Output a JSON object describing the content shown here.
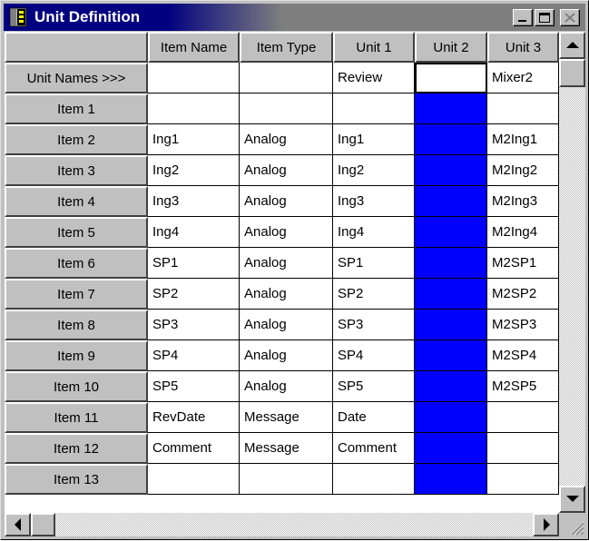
{
  "window": {
    "title": "Unit Definition"
  },
  "columns": [
    "Item Name",
    "Item Type",
    "Unit 1",
    "Unit 2",
    "Unit 3"
  ],
  "unit_names_label": "Unit Names >>>",
  "unit_names": [
    "",
    "",
    "Review",
    "",
    "Mixer2"
  ],
  "rows": [
    {
      "label": "Item 1",
      "cells": [
        "",
        "",
        "",
        "",
        ""
      ]
    },
    {
      "label": "Item 2",
      "cells": [
        "Ing1",
        "Analog",
        "Ing1",
        "",
        "M2Ing1"
      ]
    },
    {
      "label": "Item 3",
      "cells": [
        "Ing2",
        "Analog",
        "Ing2",
        "",
        "M2Ing2"
      ]
    },
    {
      "label": "Item 4",
      "cells": [
        "Ing3",
        "Analog",
        "Ing3",
        "",
        "M2Ing3"
      ]
    },
    {
      "label": "Item 5",
      "cells": [
        "Ing4",
        "Analog",
        "Ing4",
        "",
        "M2Ing4"
      ]
    },
    {
      "label": "Item 6",
      "cells": [
        "SP1",
        "Analog",
        "SP1",
        "",
        "M2SP1"
      ]
    },
    {
      "label": "Item 7",
      "cells": [
        "SP2",
        "Analog",
        "SP2",
        "",
        "M2SP2"
      ]
    },
    {
      "label": "Item 8",
      "cells": [
        "SP3",
        "Analog",
        "SP3",
        "",
        "M2SP3"
      ]
    },
    {
      "label": "Item 9",
      "cells": [
        "SP4",
        "Analog",
        "SP4",
        "",
        "M2SP4"
      ]
    },
    {
      "label": "Item 10",
      "cells": [
        "SP5",
        "Analog",
        "SP5",
        "",
        "M2SP5"
      ]
    },
    {
      "label": "Item 11",
      "cells": [
        "RevDate",
        "Message",
        "Date",
        "",
        ""
      ]
    },
    {
      "label": "Item 12",
      "cells": [
        "Comment",
        "Message",
        "Comment",
        "",
        ""
      ]
    },
    {
      "label": "Item 13",
      "cells": [
        "",
        "",
        "",
        "",
        ""
      ]
    }
  ],
  "selected_column_color": "#0000ff",
  "icons": [
    "app-icon",
    "minimize-icon",
    "maximize-icon",
    "close-icon",
    "scroll-up-arrow-icon",
    "scroll-down-arrow-icon",
    "scroll-left-arrow-icon",
    "scroll-right-arrow-icon",
    "size-grip-icon"
  ]
}
